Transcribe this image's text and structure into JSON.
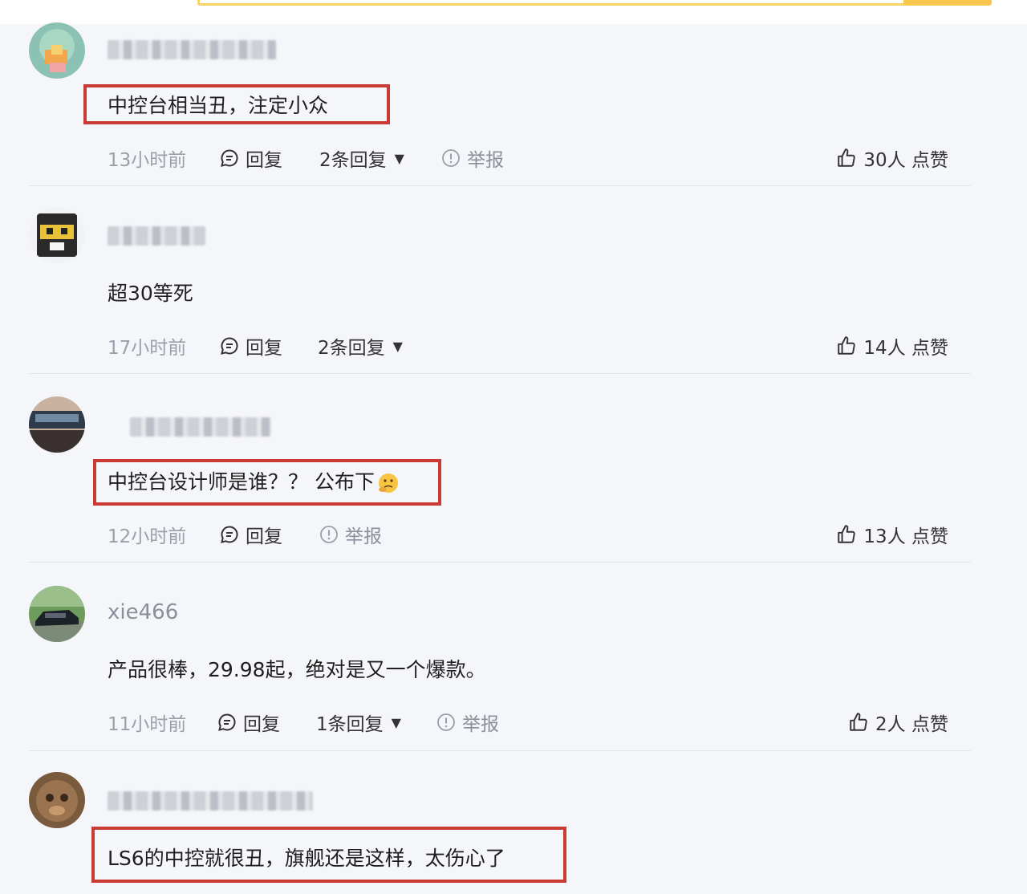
{
  "comments": [
    {
      "username": "",
      "text": "中控台相当丑，注定小众",
      "time": "13小时前",
      "reply_label": "回复",
      "replies_label": "2条回复",
      "report_label": "举报",
      "likes": "30人 点赞"
    },
    {
      "username": "",
      "text": "超30等死",
      "time": "17小时前",
      "reply_label": "回复",
      "replies_label": "2条回复",
      "likes": "14人 点赞"
    },
    {
      "username": "",
      "text": "中控台设计师是谁？？ 公布下",
      "time": "12小时前",
      "reply_label": "回复",
      "report_label": "举报",
      "likes": "13人 点赞"
    },
    {
      "username": "xie466",
      "text": "产品很棒，29.98起，绝对是又一个爆款。",
      "time": "11小时前",
      "reply_label": "回复",
      "replies_label": "1条回复",
      "report_label": "举报",
      "likes": "2人 点赞"
    },
    {
      "username": "",
      "text": "LS6的中控就很丑，旗舰还是这样，太伤心了"
    }
  ],
  "colors": {
    "highlight_box": "#c93a35",
    "search_border": "#f7d46a",
    "muted_text": "#9aa0aa"
  },
  "icons": [
    "comment-bubble-icon",
    "dropdown-triangle-icon",
    "report-exclamation-icon",
    "thumbs-up-icon",
    "thinking-face-emoji"
  ]
}
